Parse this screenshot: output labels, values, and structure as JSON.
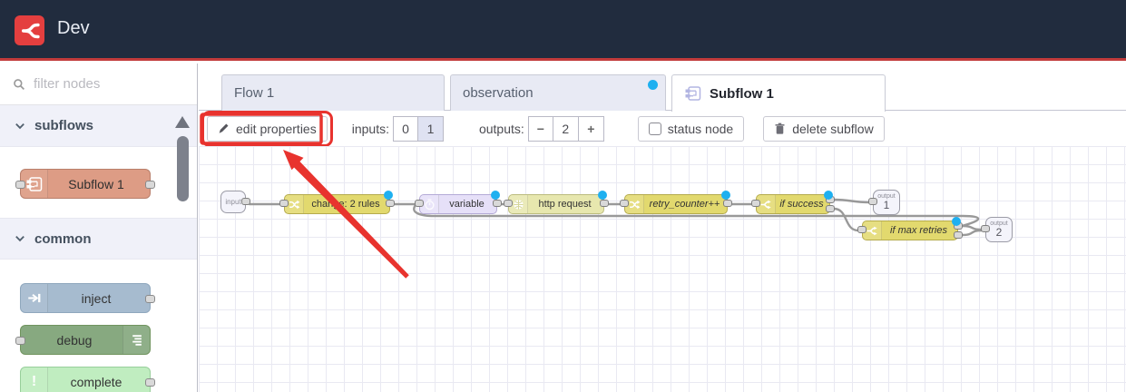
{
  "header": {
    "title": "Dev"
  },
  "sidebar": {
    "search_placeholder": "filter nodes",
    "sections": [
      {
        "label": "subflows"
      },
      {
        "label": "common"
      }
    ],
    "palette_nodes": [
      {
        "label": "Subflow 1"
      },
      {
        "label": "inject"
      },
      {
        "label": "debug"
      },
      {
        "label": "complete"
      }
    ],
    "complete_icon_glyph": "!"
  },
  "tabs": [
    {
      "label": "Flow 1",
      "active": false,
      "modified": false
    },
    {
      "label": "observation",
      "active": false,
      "modified": true
    },
    {
      "label": "Subflow 1",
      "active": true,
      "modified": false
    }
  ],
  "toolbar": {
    "edit_properties_label": "edit properties",
    "inputs_label": "inputs:",
    "input_option_0": "0",
    "input_option_1": "1",
    "selected_input": "1",
    "outputs_label": "outputs:",
    "outputs_minus": "−",
    "outputs_value": "2",
    "outputs_plus": "+",
    "status_node_label": "status node",
    "delete_subflow_label": "delete subflow"
  },
  "canvas": {
    "input_endpoint": {
      "label": "input"
    },
    "nodes": [
      {
        "label": "change: 2 rules"
      },
      {
        "label": "variable"
      },
      {
        "label": "http request"
      },
      {
        "label": "retry_counter++"
      },
      {
        "label": "if success"
      },
      {
        "label": "if max retries"
      }
    ],
    "output_endpoints": [
      {
        "caption": "output",
        "number": "1"
      },
      {
        "caption": "output",
        "number": "2"
      }
    ]
  },
  "colors": {
    "header_bg": "#212c3e",
    "logo_red": "#e43f3f",
    "yellow_node": "#e2d96e",
    "pale_yellow_node": "#e7e7ae",
    "lavender_node": "#e6e0f8",
    "subflow_node": "#dd9c85",
    "inject_node": "#a6bbcf",
    "debug_node": "#87a980",
    "complete_node": "#c0edc0",
    "modified_dot": "#1eb0f0",
    "annotation_red": "#e8332e"
  }
}
